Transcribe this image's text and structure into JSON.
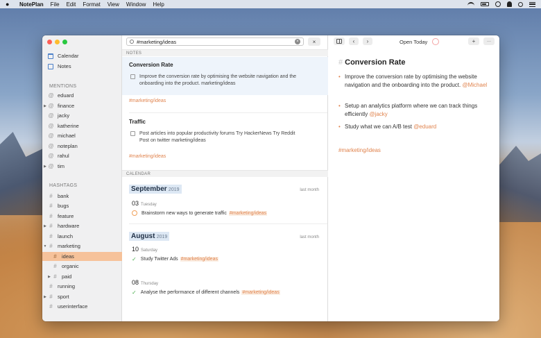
{
  "menubar": {
    "apple": "",
    "app_name": "NotePlan",
    "items": [
      "File",
      "Edit",
      "Format",
      "View",
      "Window",
      "Help"
    ]
  },
  "sidebar": {
    "calendar_label": "Calendar",
    "notes_label": "Notes",
    "mentions_heading": "MENTIONS",
    "mentions": [
      "eduard",
      "finance",
      "jacky",
      "katherine",
      "michael",
      "noteplan",
      "rahul",
      "tim"
    ],
    "hashtags_heading": "HASHTAGS",
    "hashtags": [
      "bank",
      "bugs",
      "feature",
      "hardware",
      "launch",
      "marketing",
      "ideas",
      "organic",
      "paid",
      "running",
      "sport",
      "userinterface"
    ]
  },
  "search": {
    "value": "#marketing/ideas",
    "clear": "×",
    "close": "×"
  },
  "notes_section": {
    "heading": "NOTES",
    "cards": [
      {
        "title": "Conversion Rate",
        "line1": "Improve the conversion rate by optimising the website navigation and the",
        "line2": "onboarding into the product. marketing/ideas",
        "tag": "#marketing/ideas"
      },
      {
        "title": "Traffic",
        "line1": "Post articles into popular productivity forums Try HackerNews Try Reddit",
        "line2": "Post on twitter marketing/ideas",
        "tag": "#marketing/ideas"
      }
    ]
  },
  "calendar_section": {
    "heading": "CALENDAR",
    "months": [
      {
        "name": "September",
        "year": "2019",
        "relative": "last month",
        "days": [
          {
            "num": "03",
            "weekday": "Tuesday",
            "task": "Brainstorm new ways to generate traffic",
            "tag": "#marketing/ideas"
          }
        ]
      },
      {
        "name": "August",
        "year": "2019",
        "relative": "last month",
        "days": [
          {
            "num": "10",
            "weekday": "Saturday",
            "task": "Study Twitter Ads",
            "tag": "#marketing/ideas"
          },
          {
            "num": "08",
            "weekday": "Thursday",
            "task": "Analyse the performance of different channels",
            "tag": "#marketing/ideas"
          }
        ]
      }
    ]
  },
  "editor": {
    "toolbar": {
      "back": "‹",
      "forward": "›",
      "open_today": "Open Today",
      "add": "+",
      "more": "···"
    },
    "title_hash": "#",
    "title": "Conversion Rate",
    "bullets": [
      {
        "text": "Improve the conversion rate by optimising the website navigation and the onboarding into the product.",
        "mention": "@Michael"
      },
      {
        "text": "Setup an analytics platform where we can track things efficiently",
        "mention": "@jacky"
      },
      {
        "text": "Study what we can A/B test",
        "mention": "@eduard"
      }
    ],
    "tag": "#marketing/ideas",
    "bullet_char": "•"
  },
  "colors": {
    "accent": "#e0834d",
    "selection": "#f6c29a",
    "link_blue": "#4a7fc9"
  }
}
